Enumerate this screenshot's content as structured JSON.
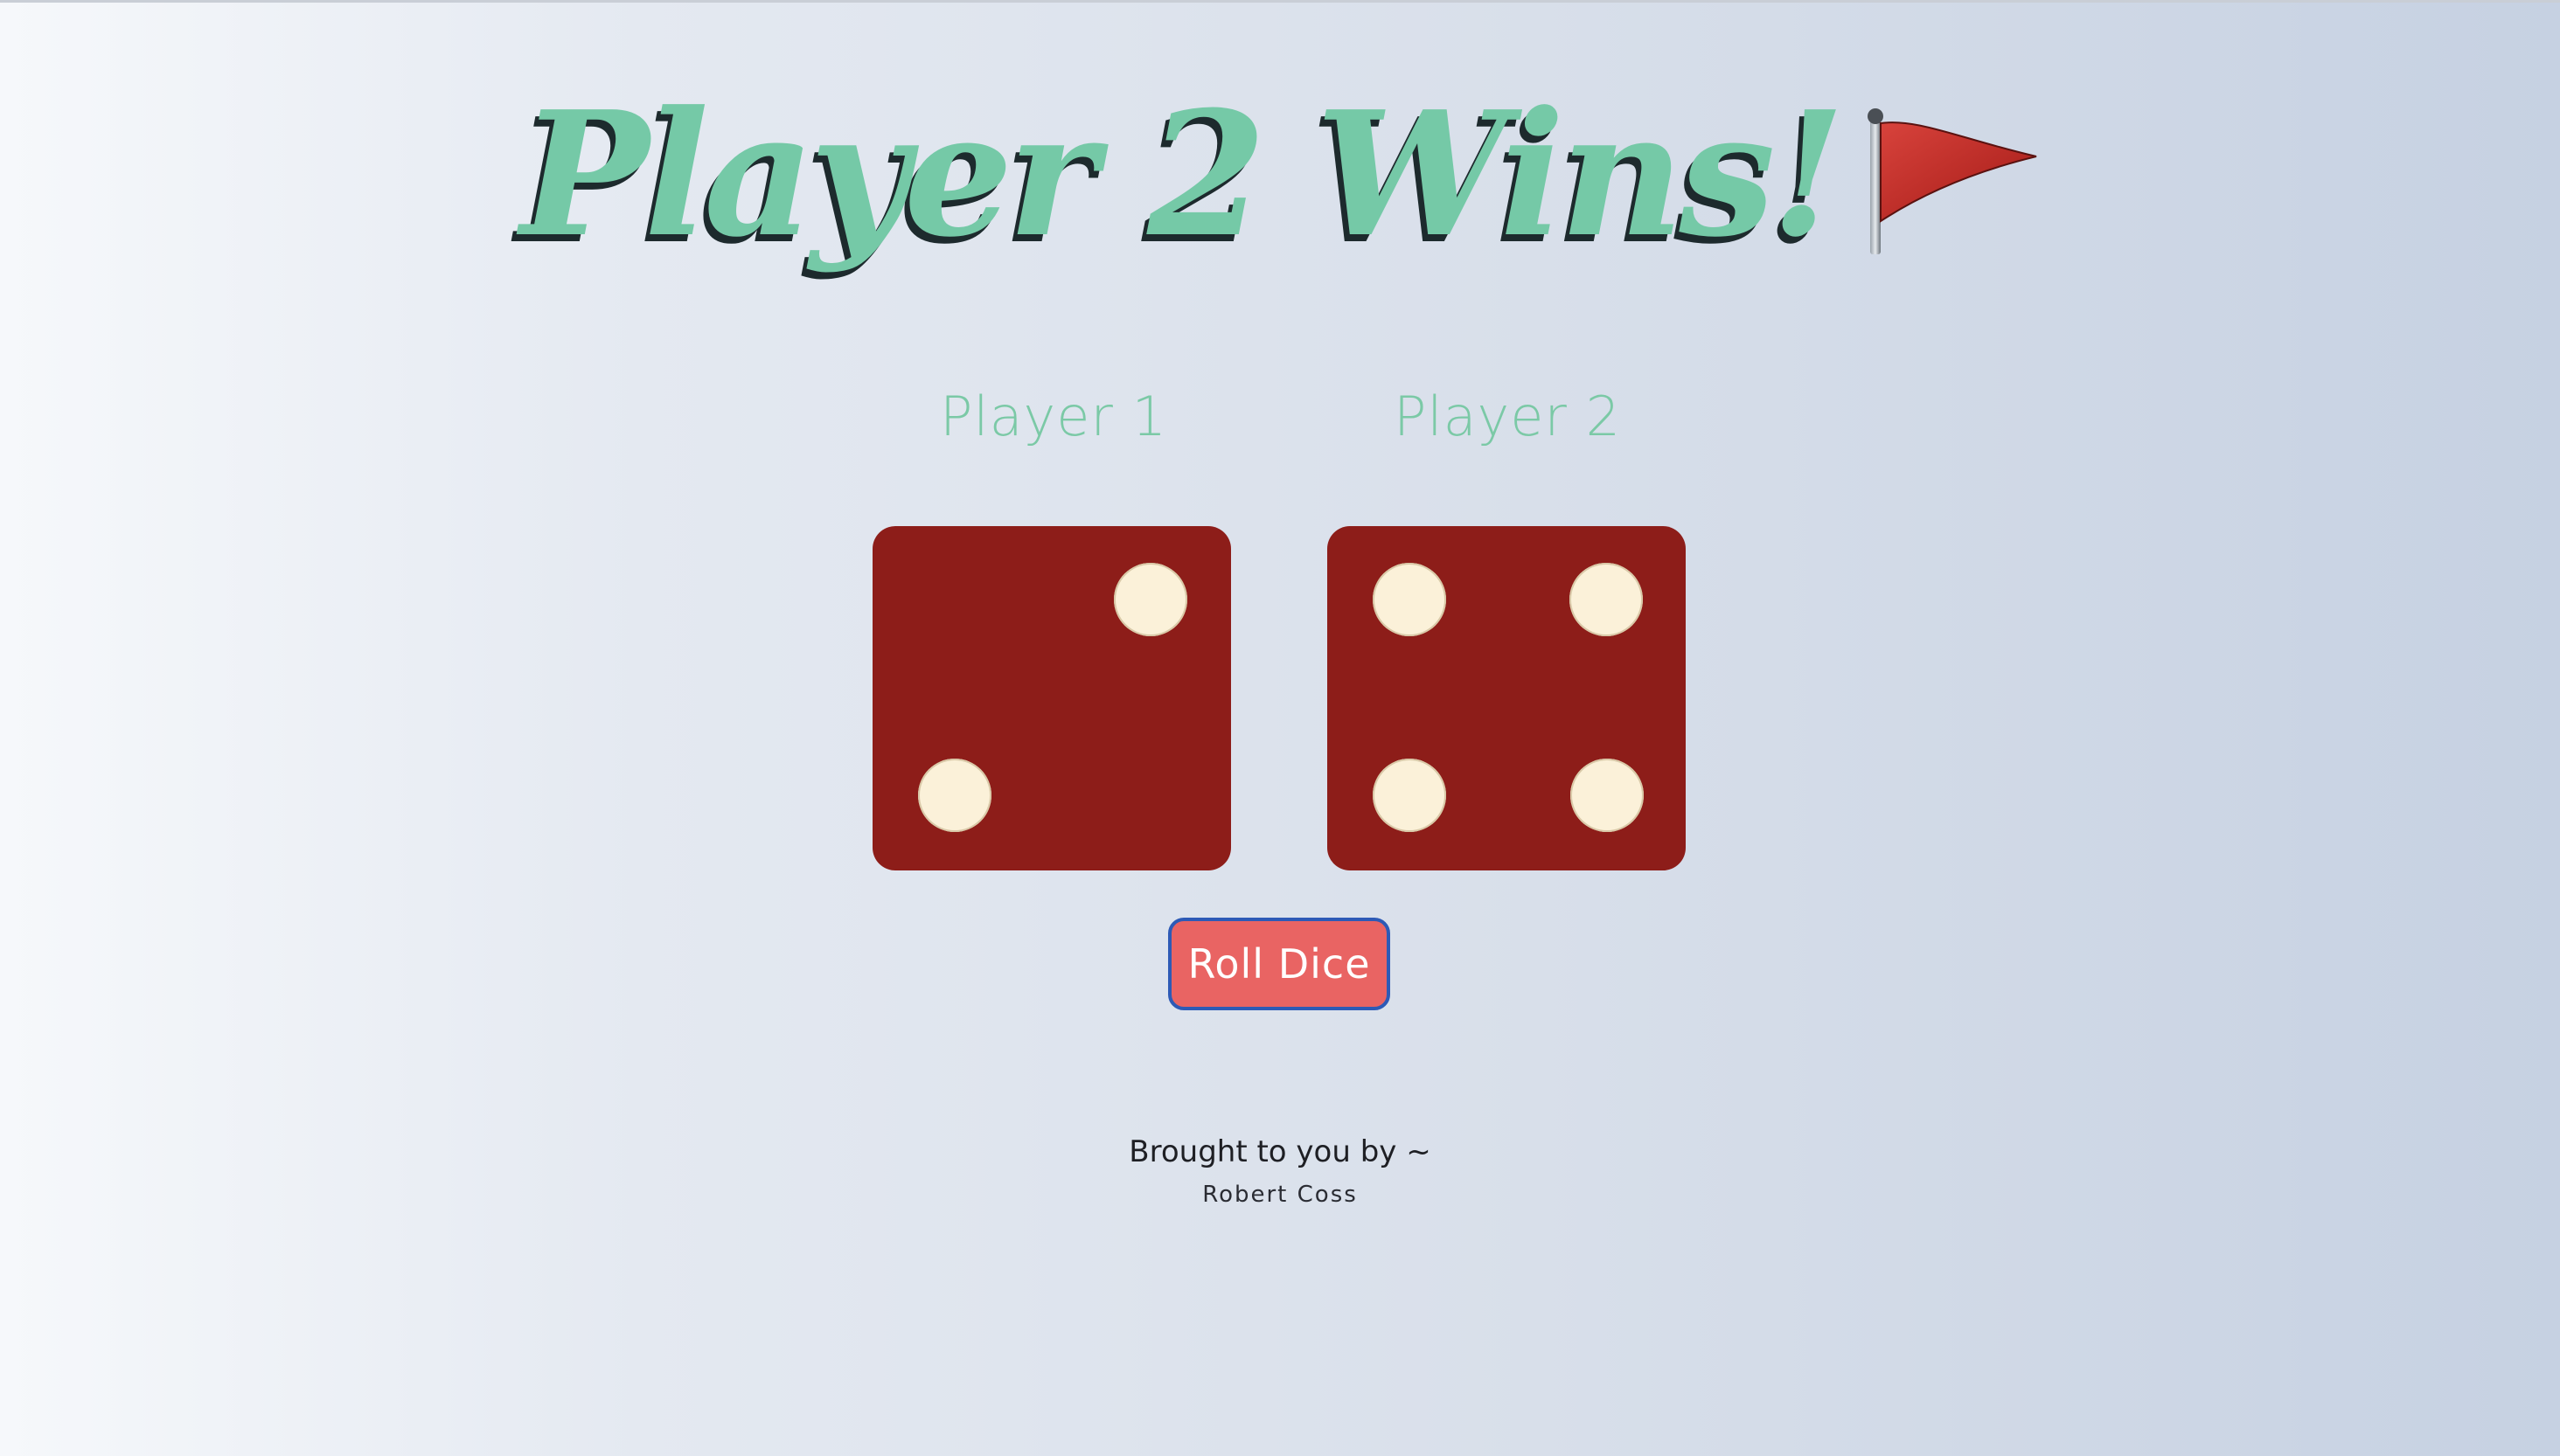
{
  "page": {
    "title": "Player 2 Wins!",
    "title_icon": "red-flag-icon"
  },
  "players": [
    {
      "label": "Player 1",
      "die_value": 2
    },
    {
      "label": "Player 2",
      "die_value": 4
    }
  ],
  "controls": {
    "roll_button_label": "Roll Dice"
  },
  "footer": {
    "byline": "Brought to you by ~",
    "author": "Robert Coss"
  },
  "colors": {
    "title_green": "#75c9a7",
    "title_shadow": "#1d2a2d",
    "die_red": "#8d1d19",
    "pip_cream": "#fbf1d9",
    "button_red": "#e96463",
    "button_border": "#2d5ab6",
    "flag_red": "#c0302b"
  }
}
